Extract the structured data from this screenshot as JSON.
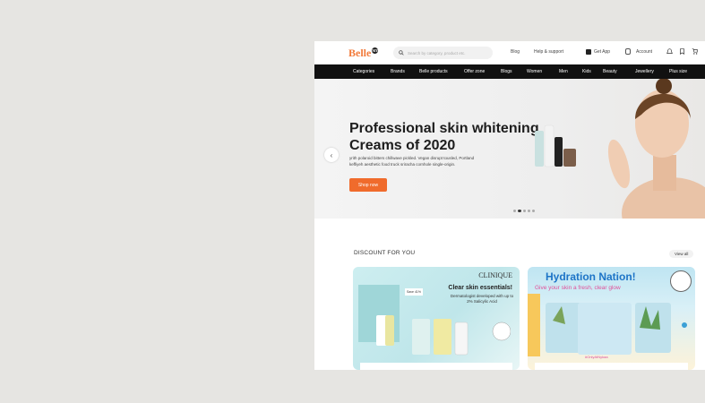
{
  "header": {
    "brand": "Belle",
    "brand_badge": "MY",
    "search_placeholder": "Search by category, product etc.",
    "links": [
      "Blog",
      "Help & support",
      "Get App",
      "Account"
    ]
  },
  "nav": [
    "Categories",
    "Brands",
    "Belle products",
    "Offer zone",
    "Blogs",
    "Women",
    "Men",
    "Kids",
    "Beauty",
    "Jewellery",
    "Plus size"
  ],
  "hero": {
    "title": "Professional skin whitening Creams of 2020",
    "text": "yrith polaroid bitters chillwave pickled. Vegan disrupt tousled, Portland keffiyeh aesthetic food truck sriracha cornhole single-origin.",
    "cta": "Shop now"
  },
  "discount": {
    "title": "DISCOUNT FOR YOU",
    "view_all": "View all",
    "card1": {
      "brand": "CLINIQUE",
      "headline": "Clear skin essentials!",
      "sub": "Dermatologist developed with up to 2% Salicylic Acid",
      "tag": "Save 41%"
    },
    "card2": {
      "headline": "Hydration Nation!",
      "sub": "Give your skin a fresh, clear glow",
      "hashtag": "#OnlyAtNykaa"
    }
  },
  "colors": {
    "accent": "#f06b2c",
    "nav_bg": "#111111"
  }
}
